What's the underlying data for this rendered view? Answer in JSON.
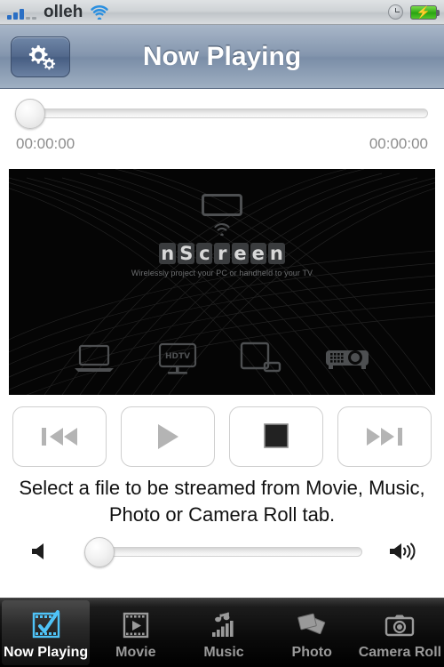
{
  "status_bar": {
    "signal_icon": "signal-bars-icon",
    "signal_bars_filled": 3,
    "signal_bars_total": 5,
    "carrier": "olleh",
    "wifi_icon": "wifi-icon",
    "clock_icon": "clock-icon",
    "battery_icon": "battery-charging-icon",
    "battery_state": "charging"
  },
  "navbar": {
    "settings_icon": "gears-icon",
    "title": "Now Playing"
  },
  "progress": {
    "slider_name": "playback-scrubber",
    "value_percent": 0,
    "elapsed": "00:00:00",
    "remaining": "00:00:00"
  },
  "splash": {
    "tv_icon": "tv-screen-icon",
    "wifi_icon": "wifi-waves-icon",
    "logo_letters": [
      "n",
      "S",
      "c",
      "r",
      "e",
      "e",
      "n"
    ],
    "tagline": "Wirelessly project your PC or handheld to your TV",
    "devices": [
      {
        "icon": "laptop-icon",
        "label": ""
      },
      {
        "icon": "hdtv-icon",
        "label": "HDTV"
      },
      {
        "icon": "tablet-phone-icon",
        "label": ""
      },
      {
        "icon": "projector-icon",
        "label": ""
      }
    ],
    "background_color": "#050505"
  },
  "transport": {
    "buttons": [
      {
        "name": "previous-button",
        "icon": "rewind-icon",
        "enabled": false,
        "color": "#b4b4b4"
      },
      {
        "name": "play-button",
        "icon": "play-icon",
        "enabled": false,
        "color": "#b4b4b4"
      },
      {
        "name": "stop-button",
        "icon": "stop-icon",
        "enabled": true,
        "color": "#222222"
      },
      {
        "name": "next-button",
        "icon": "fast-forward-icon",
        "enabled": false,
        "color": "#b4b4b4"
      }
    ]
  },
  "hint": {
    "text": "Select a file to be streamed from Movie, Music, Photo or Camera Roll tab."
  },
  "volume": {
    "slider_name": "volume-slider",
    "value_percent": 0,
    "mute_icon": "speaker-mute-icon",
    "loud_icon": "speaker-loud-icon"
  },
  "tabbar": {
    "tabs": [
      {
        "label": "Now Playing",
        "icon": "film-check-icon",
        "active": true
      },
      {
        "label": "Movie",
        "icon": "film-play-icon",
        "active": false
      },
      {
        "label": "Music",
        "icon": "music-note-icon",
        "active": false
      },
      {
        "label": "Photo",
        "icon": "photo-stack-icon",
        "active": false
      },
      {
        "label": "Camera Roll",
        "icon": "camera-icon",
        "active": false
      }
    ],
    "active_color": "#ffffff",
    "inactive_color": "#9a9a9a",
    "accent_color": "#4fc3f7"
  }
}
